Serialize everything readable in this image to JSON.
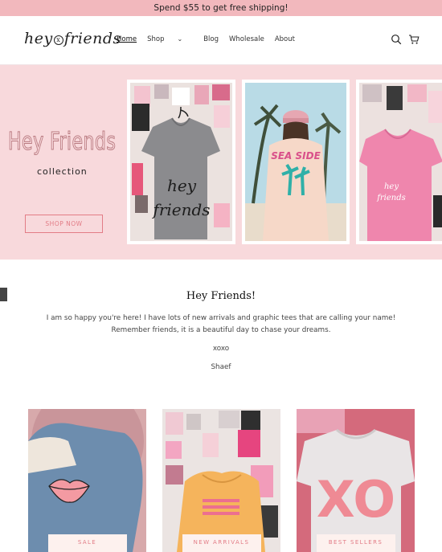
{
  "announcement": "Spend $55 to get free shipping!",
  "logo": {
    "left": "hey",
    "mark": "x",
    "right": "friends"
  },
  "nav": {
    "home": "Home",
    "shop": "Shop",
    "blog": "Blog",
    "wholesale": "Wholesale",
    "about": "About"
  },
  "icons": {
    "search": "search-icon",
    "cart": "cart-icon",
    "chevron": "chevron-down-icon"
  },
  "hero": {
    "title": "Hey Friends",
    "subtitle": "collection",
    "cta": "SHOP NOW",
    "tee1_text": "hey friends",
    "tee2_text": "SEA SIDE",
    "tee3_text": "hey friends"
  },
  "intro": {
    "title": "Hey Friends!",
    "body": "I am so happy you're here! I have lots of new arrivals and graphic tees that are calling your name! Remember friends, it is a beautiful day to chase your dreams.",
    "xoxo": "xoxo",
    "signature": "Shaef"
  },
  "collections": [
    {
      "label": "SALE"
    },
    {
      "label": "NEW ARRIVALS"
    },
    {
      "label": "BEST SELLERS",
      "print": "XO"
    }
  ],
  "colors": {
    "accent": "#e27c86",
    "banner": "#f2b8bd",
    "hero_bg": "#f8d9dc"
  }
}
